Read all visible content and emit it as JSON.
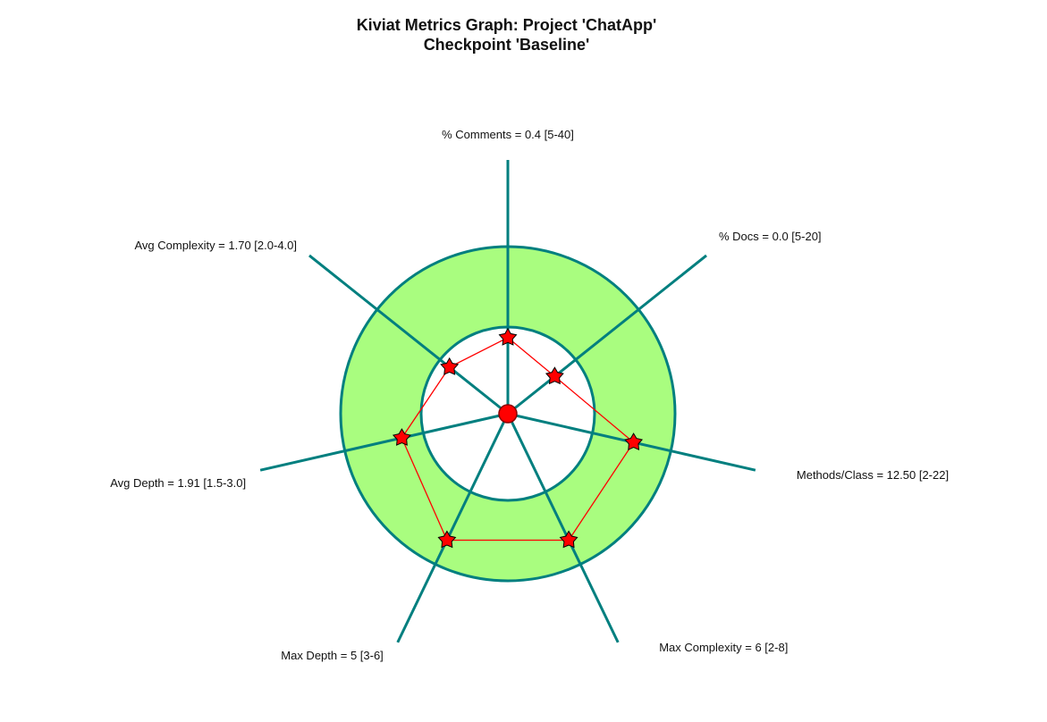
{
  "chart_data": {
    "type": "radar",
    "title": "Kiviat Metrics Graph: Project 'ChatApp'",
    "subtitle": "Checkpoint 'Baseline'",
    "axes": [
      {
        "label": "% Comments = 0.4 [5-40]",
        "metric": "% Comments",
        "value": 0.4,
        "min": 5,
        "max": 40
      },
      {
        "label": "% Docs = 0.0 [5-20]",
        "metric": "% Docs",
        "value": 0.0,
        "min": 5,
        "max": 20
      },
      {
        "label": "Methods/Class = 12.50 [2-22]",
        "metric": "Methods/Class",
        "value": 12.5,
        "min": 2,
        "max": 22
      },
      {
        "label": "Max Complexity = 6 [2-8]",
        "metric": "Max Complexity",
        "value": 6,
        "min": 2,
        "max": 8
      },
      {
        "label": "Max Depth = 5 [3-6]",
        "metric": "Max Depth",
        "value": 5,
        "min": 3,
        "max": 6
      },
      {
        "label": "Avg Depth = 1.91 [1.5-3.0]",
        "metric": "Avg Depth",
        "value": 1.91,
        "min": 1.5,
        "max": 3.0
      },
      {
        "label": "Avg Complexity = 1.70 [2.0-4.0]",
        "metric": "Avg Complexity",
        "value": 1.7,
        "min": 2.0,
        "max": 4.0
      }
    ],
    "colors": {
      "band_fill": "#a9fd7f",
      "axis": "#007f7f",
      "polygon": "#ff0000",
      "marker_fill": "#ff0000",
      "marker_stroke": "#000000"
    }
  }
}
